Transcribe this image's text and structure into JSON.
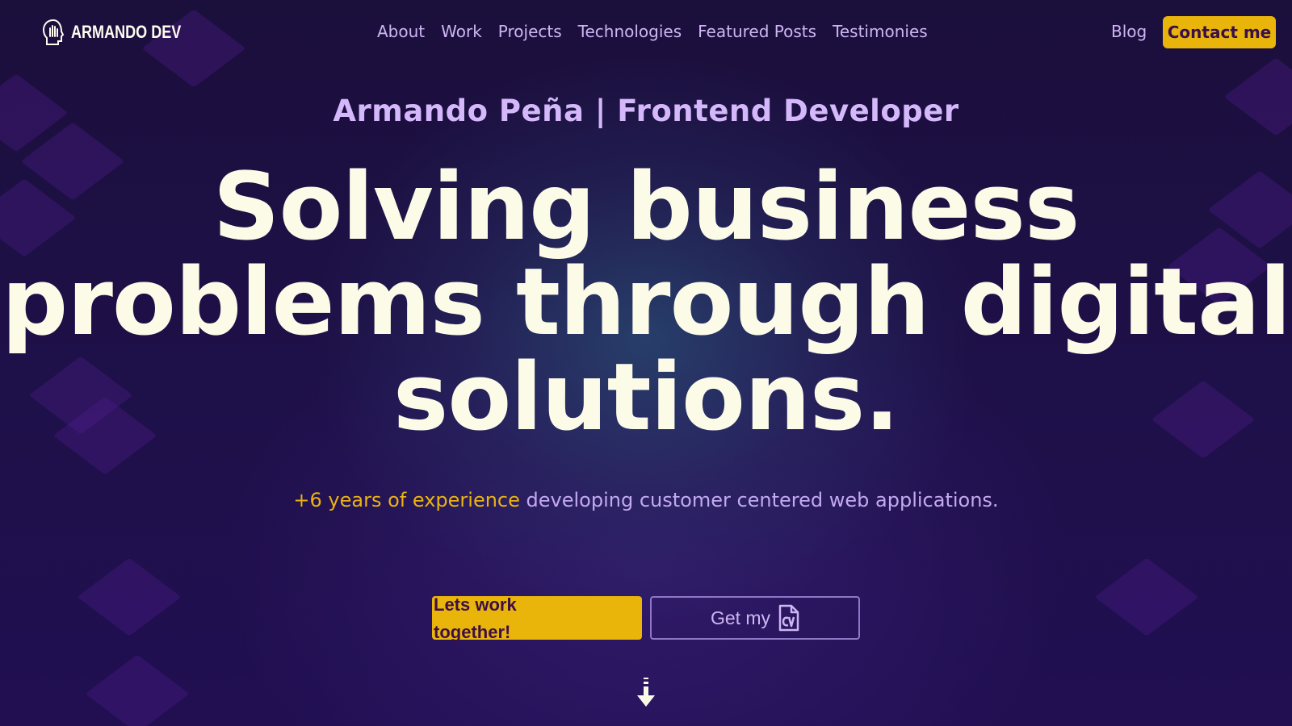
{
  "brand": {
    "logo_text": "ARMANDO DEV",
    "logo_icon": "head-hand-icon"
  },
  "nav": {
    "items": [
      {
        "label": "About"
      },
      {
        "label": "Work"
      },
      {
        "label": "Projects"
      },
      {
        "label": "Technologies"
      },
      {
        "label": "Featured Posts"
      },
      {
        "label": "Testimonies"
      }
    ],
    "blog_label": "Blog",
    "contact_label": "Contact me"
  },
  "hero": {
    "subtitle": "Armando Peña | Frontend Developer",
    "headline": "Solving business problems through digital solutions.",
    "tagline_accent": "+6 years of experience",
    "tagline_rest": " developing customer centered web applications.",
    "primary_button": "Lets work together!",
    "secondary_button": "Get my",
    "secondary_icon": "cv-file-icon",
    "scroll_icon": "arrow-down-icon"
  },
  "colors": {
    "background": "#1e1048",
    "accent": "#e9b50b",
    "lavender": "#cdb6f2",
    "headline": "#fcfbe8"
  }
}
